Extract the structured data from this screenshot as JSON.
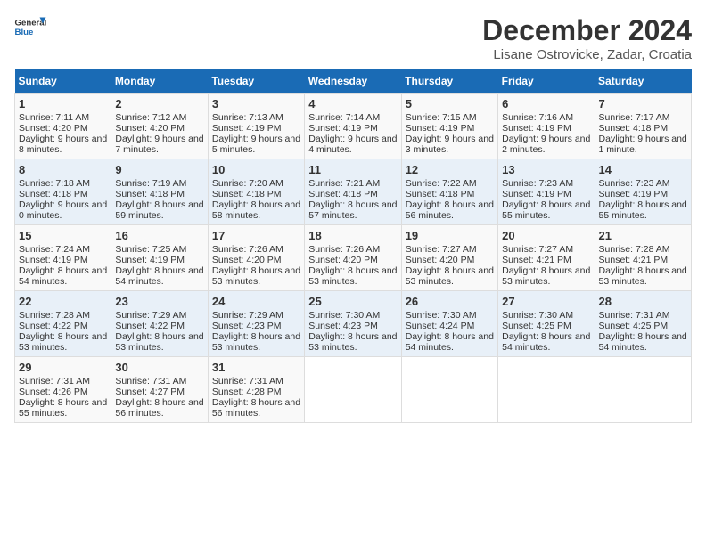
{
  "logo": {
    "line1": "General",
    "line2": "Blue"
  },
  "title": "December 2024",
  "subtitle": "Lisane Ostrovicke, Zadar, Croatia",
  "days_of_week": [
    "Sunday",
    "Monday",
    "Tuesday",
    "Wednesday",
    "Thursday",
    "Friday",
    "Saturday"
  ],
  "weeks": [
    [
      {
        "day": 1,
        "sunrise": "7:11 AM",
        "sunset": "4:20 PM",
        "daylight": "9 hours and 8 minutes."
      },
      {
        "day": 2,
        "sunrise": "7:12 AM",
        "sunset": "4:20 PM",
        "daylight": "9 hours and 7 minutes."
      },
      {
        "day": 3,
        "sunrise": "7:13 AM",
        "sunset": "4:19 PM",
        "daylight": "9 hours and 5 minutes."
      },
      {
        "day": 4,
        "sunrise": "7:14 AM",
        "sunset": "4:19 PM",
        "daylight": "9 hours and 4 minutes."
      },
      {
        "day": 5,
        "sunrise": "7:15 AM",
        "sunset": "4:19 PM",
        "daylight": "9 hours and 3 minutes."
      },
      {
        "day": 6,
        "sunrise": "7:16 AM",
        "sunset": "4:19 PM",
        "daylight": "9 hours and 2 minutes."
      },
      {
        "day": 7,
        "sunrise": "7:17 AM",
        "sunset": "4:18 PM",
        "daylight": "9 hours and 1 minute."
      }
    ],
    [
      {
        "day": 8,
        "sunrise": "7:18 AM",
        "sunset": "4:18 PM",
        "daylight": "9 hours and 0 minutes."
      },
      {
        "day": 9,
        "sunrise": "7:19 AM",
        "sunset": "4:18 PM",
        "daylight": "8 hours and 59 minutes."
      },
      {
        "day": 10,
        "sunrise": "7:20 AM",
        "sunset": "4:18 PM",
        "daylight": "8 hours and 58 minutes."
      },
      {
        "day": 11,
        "sunrise": "7:21 AM",
        "sunset": "4:18 PM",
        "daylight": "8 hours and 57 minutes."
      },
      {
        "day": 12,
        "sunrise": "7:22 AM",
        "sunset": "4:18 PM",
        "daylight": "8 hours and 56 minutes."
      },
      {
        "day": 13,
        "sunrise": "7:23 AM",
        "sunset": "4:19 PM",
        "daylight": "8 hours and 55 minutes."
      },
      {
        "day": 14,
        "sunrise": "7:23 AM",
        "sunset": "4:19 PM",
        "daylight": "8 hours and 55 minutes."
      }
    ],
    [
      {
        "day": 15,
        "sunrise": "7:24 AM",
        "sunset": "4:19 PM",
        "daylight": "8 hours and 54 minutes."
      },
      {
        "day": 16,
        "sunrise": "7:25 AM",
        "sunset": "4:19 PM",
        "daylight": "8 hours and 54 minutes."
      },
      {
        "day": 17,
        "sunrise": "7:26 AM",
        "sunset": "4:20 PM",
        "daylight": "8 hours and 53 minutes."
      },
      {
        "day": 18,
        "sunrise": "7:26 AM",
        "sunset": "4:20 PM",
        "daylight": "8 hours and 53 minutes."
      },
      {
        "day": 19,
        "sunrise": "7:27 AM",
        "sunset": "4:20 PM",
        "daylight": "8 hours and 53 minutes."
      },
      {
        "day": 20,
        "sunrise": "7:27 AM",
        "sunset": "4:21 PM",
        "daylight": "8 hours and 53 minutes."
      },
      {
        "day": 21,
        "sunrise": "7:28 AM",
        "sunset": "4:21 PM",
        "daylight": "8 hours and 53 minutes."
      }
    ],
    [
      {
        "day": 22,
        "sunrise": "7:28 AM",
        "sunset": "4:22 PM",
        "daylight": "8 hours and 53 minutes."
      },
      {
        "day": 23,
        "sunrise": "7:29 AM",
        "sunset": "4:22 PM",
        "daylight": "8 hours and 53 minutes."
      },
      {
        "day": 24,
        "sunrise": "7:29 AM",
        "sunset": "4:23 PM",
        "daylight": "8 hours and 53 minutes."
      },
      {
        "day": 25,
        "sunrise": "7:30 AM",
        "sunset": "4:23 PM",
        "daylight": "8 hours and 53 minutes."
      },
      {
        "day": 26,
        "sunrise": "7:30 AM",
        "sunset": "4:24 PM",
        "daylight": "8 hours and 54 minutes."
      },
      {
        "day": 27,
        "sunrise": "7:30 AM",
        "sunset": "4:25 PM",
        "daylight": "8 hours and 54 minutes."
      },
      {
        "day": 28,
        "sunrise": "7:31 AM",
        "sunset": "4:25 PM",
        "daylight": "8 hours and 54 minutes."
      }
    ],
    [
      {
        "day": 29,
        "sunrise": "7:31 AM",
        "sunset": "4:26 PM",
        "daylight": "8 hours and 55 minutes."
      },
      {
        "day": 30,
        "sunrise": "7:31 AM",
        "sunset": "4:27 PM",
        "daylight": "8 hours and 56 minutes."
      },
      {
        "day": 31,
        "sunrise": "7:31 AM",
        "sunset": "4:28 PM",
        "daylight": "8 hours and 56 minutes."
      },
      null,
      null,
      null,
      null
    ]
  ],
  "labels": {
    "sunrise": "Sunrise:",
    "sunset": "Sunset:",
    "daylight": "Daylight hours"
  }
}
